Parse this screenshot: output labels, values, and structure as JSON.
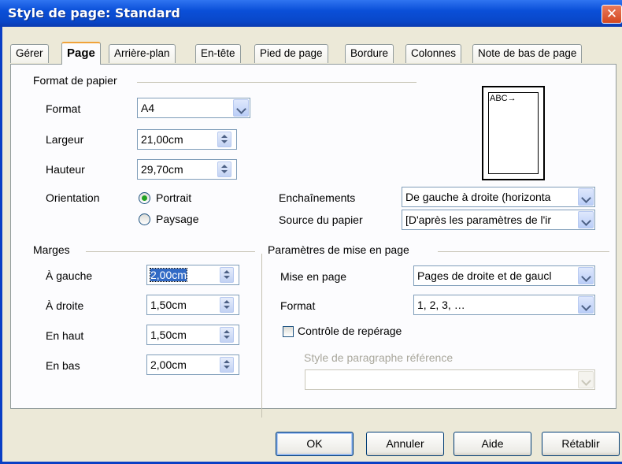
{
  "window": {
    "title": "Style de page: Standard",
    "close_glyph": "✕"
  },
  "tabs": [
    {
      "label": "Gérer"
    },
    {
      "label": "Page"
    },
    {
      "label": "Arrière-plan"
    },
    {
      "label": "En-tête"
    },
    {
      "label": "Pied de page"
    },
    {
      "label": "Bordure"
    },
    {
      "label": "Colonnes"
    },
    {
      "label": "Note de bas de page"
    }
  ],
  "paper": {
    "group_label": "Format de papier",
    "format_label": "Format",
    "format_value": "A4",
    "width_label": "Largeur",
    "width_value": "21,00cm",
    "height_label": "Hauteur",
    "height_value": "29,70cm",
    "orientation_label": "Orientation",
    "portrait_label": "Portrait",
    "landscape_label": "Paysage",
    "orientation_selected": "Portrait",
    "preview_text": "ABC→"
  },
  "flow": {
    "text_direction_label": "Enchaînements",
    "text_direction_value": "De gauche à droite (horizonta",
    "paper_tray_label": "Source du papier",
    "paper_tray_value": "[D'après les paramètres de l'ir"
  },
  "margins": {
    "group_label": "Marges",
    "left_label": "À gauche",
    "left_value": "2,00cm",
    "right_label": "À droite",
    "right_value": "1,50cm",
    "top_label": "En haut",
    "top_value": "1,50cm",
    "bottom_label": "En bas",
    "bottom_value": "2,00cm"
  },
  "layout": {
    "group_label": "Paramètres de mise en page",
    "page_layout_label": "Mise en page",
    "page_layout_value": "Pages de droite et de gaucl",
    "format_label": "Format",
    "format_value": "1, 2, 3, …",
    "register_label": "Contrôle de repérage",
    "register_checked": false,
    "ref_style_label": "Style de paragraphe référence",
    "ref_style_value": ""
  },
  "buttons": {
    "ok": "OK",
    "cancel": "Annuler",
    "help": "Aide",
    "reset": "Rétablir"
  },
  "colors": {
    "titlebar": "#0a4fd8",
    "dialog_bg": "#ece9d8",
    "panel_bg": "#fcfcfe",
    "selection": "#316ac5",
    "active_tab_accent": "#f0a33a"
  }
}
